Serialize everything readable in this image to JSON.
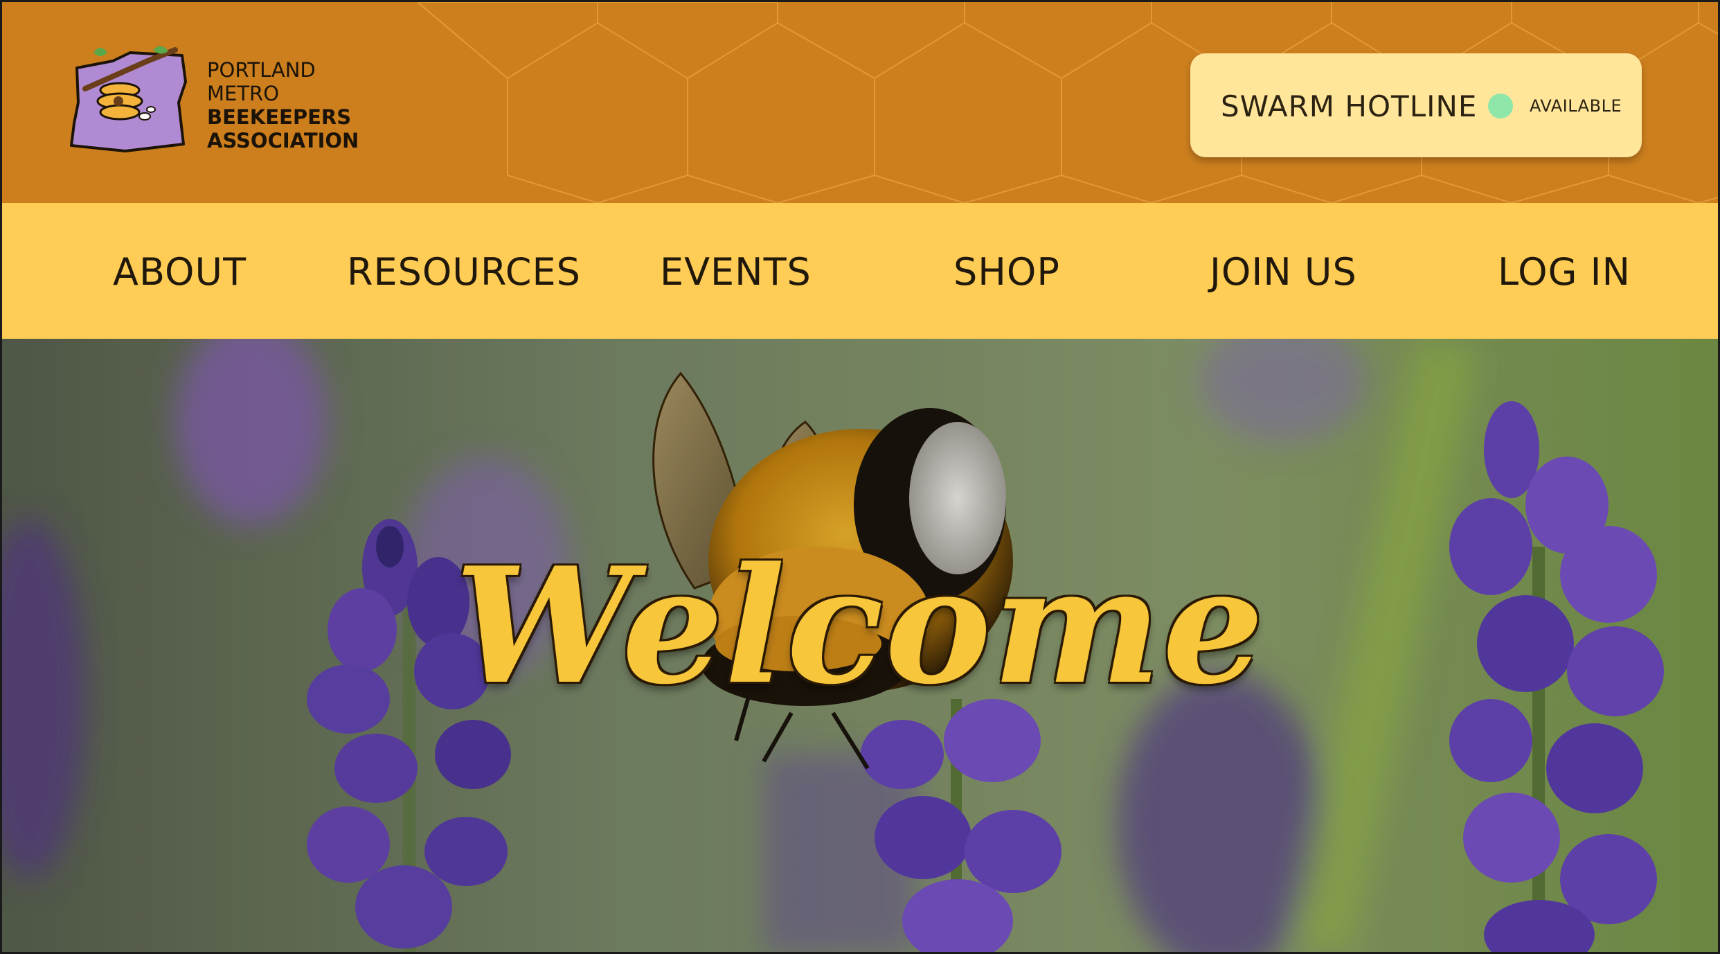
{
  "header": {
    "logo": {
      "line1": "PORTLAND",
      "line2": "METRO",
      "line3": "BEEKEEPERS",
      "line4": "ASSOCIATION",
      "icon": "oregon-beehive-logo-icon"
    },
    "hotline": {
      "label": "SWARM HOTLINE",
      "status": "AVAILABLE",
      "status_color": "#8ee6a8"
    }
  },
  "nav": {
    "items": [
      {
        "label": "ABOUT"
      },
      {
        "label": "RESOURCES"
      },
      {
        "label": "EVENTS"
      },
      {
        "label": "SHOP"
      },
      {
        "label": "JOIN US"
      },
      {
        "label": "LOG IN"
      }
    ]
  },
  "hero": {
    "heading": "Welcome",
    "image": "bumblebee-on-lavender-photo"
  },
  "colors": {
    "header_bg": "#cd7f1e",
    "nav_bg": "#ffcc55",
    "hotline_bg": "#ffe69a",
    "welcome": "#f8c63a"
  }
}
